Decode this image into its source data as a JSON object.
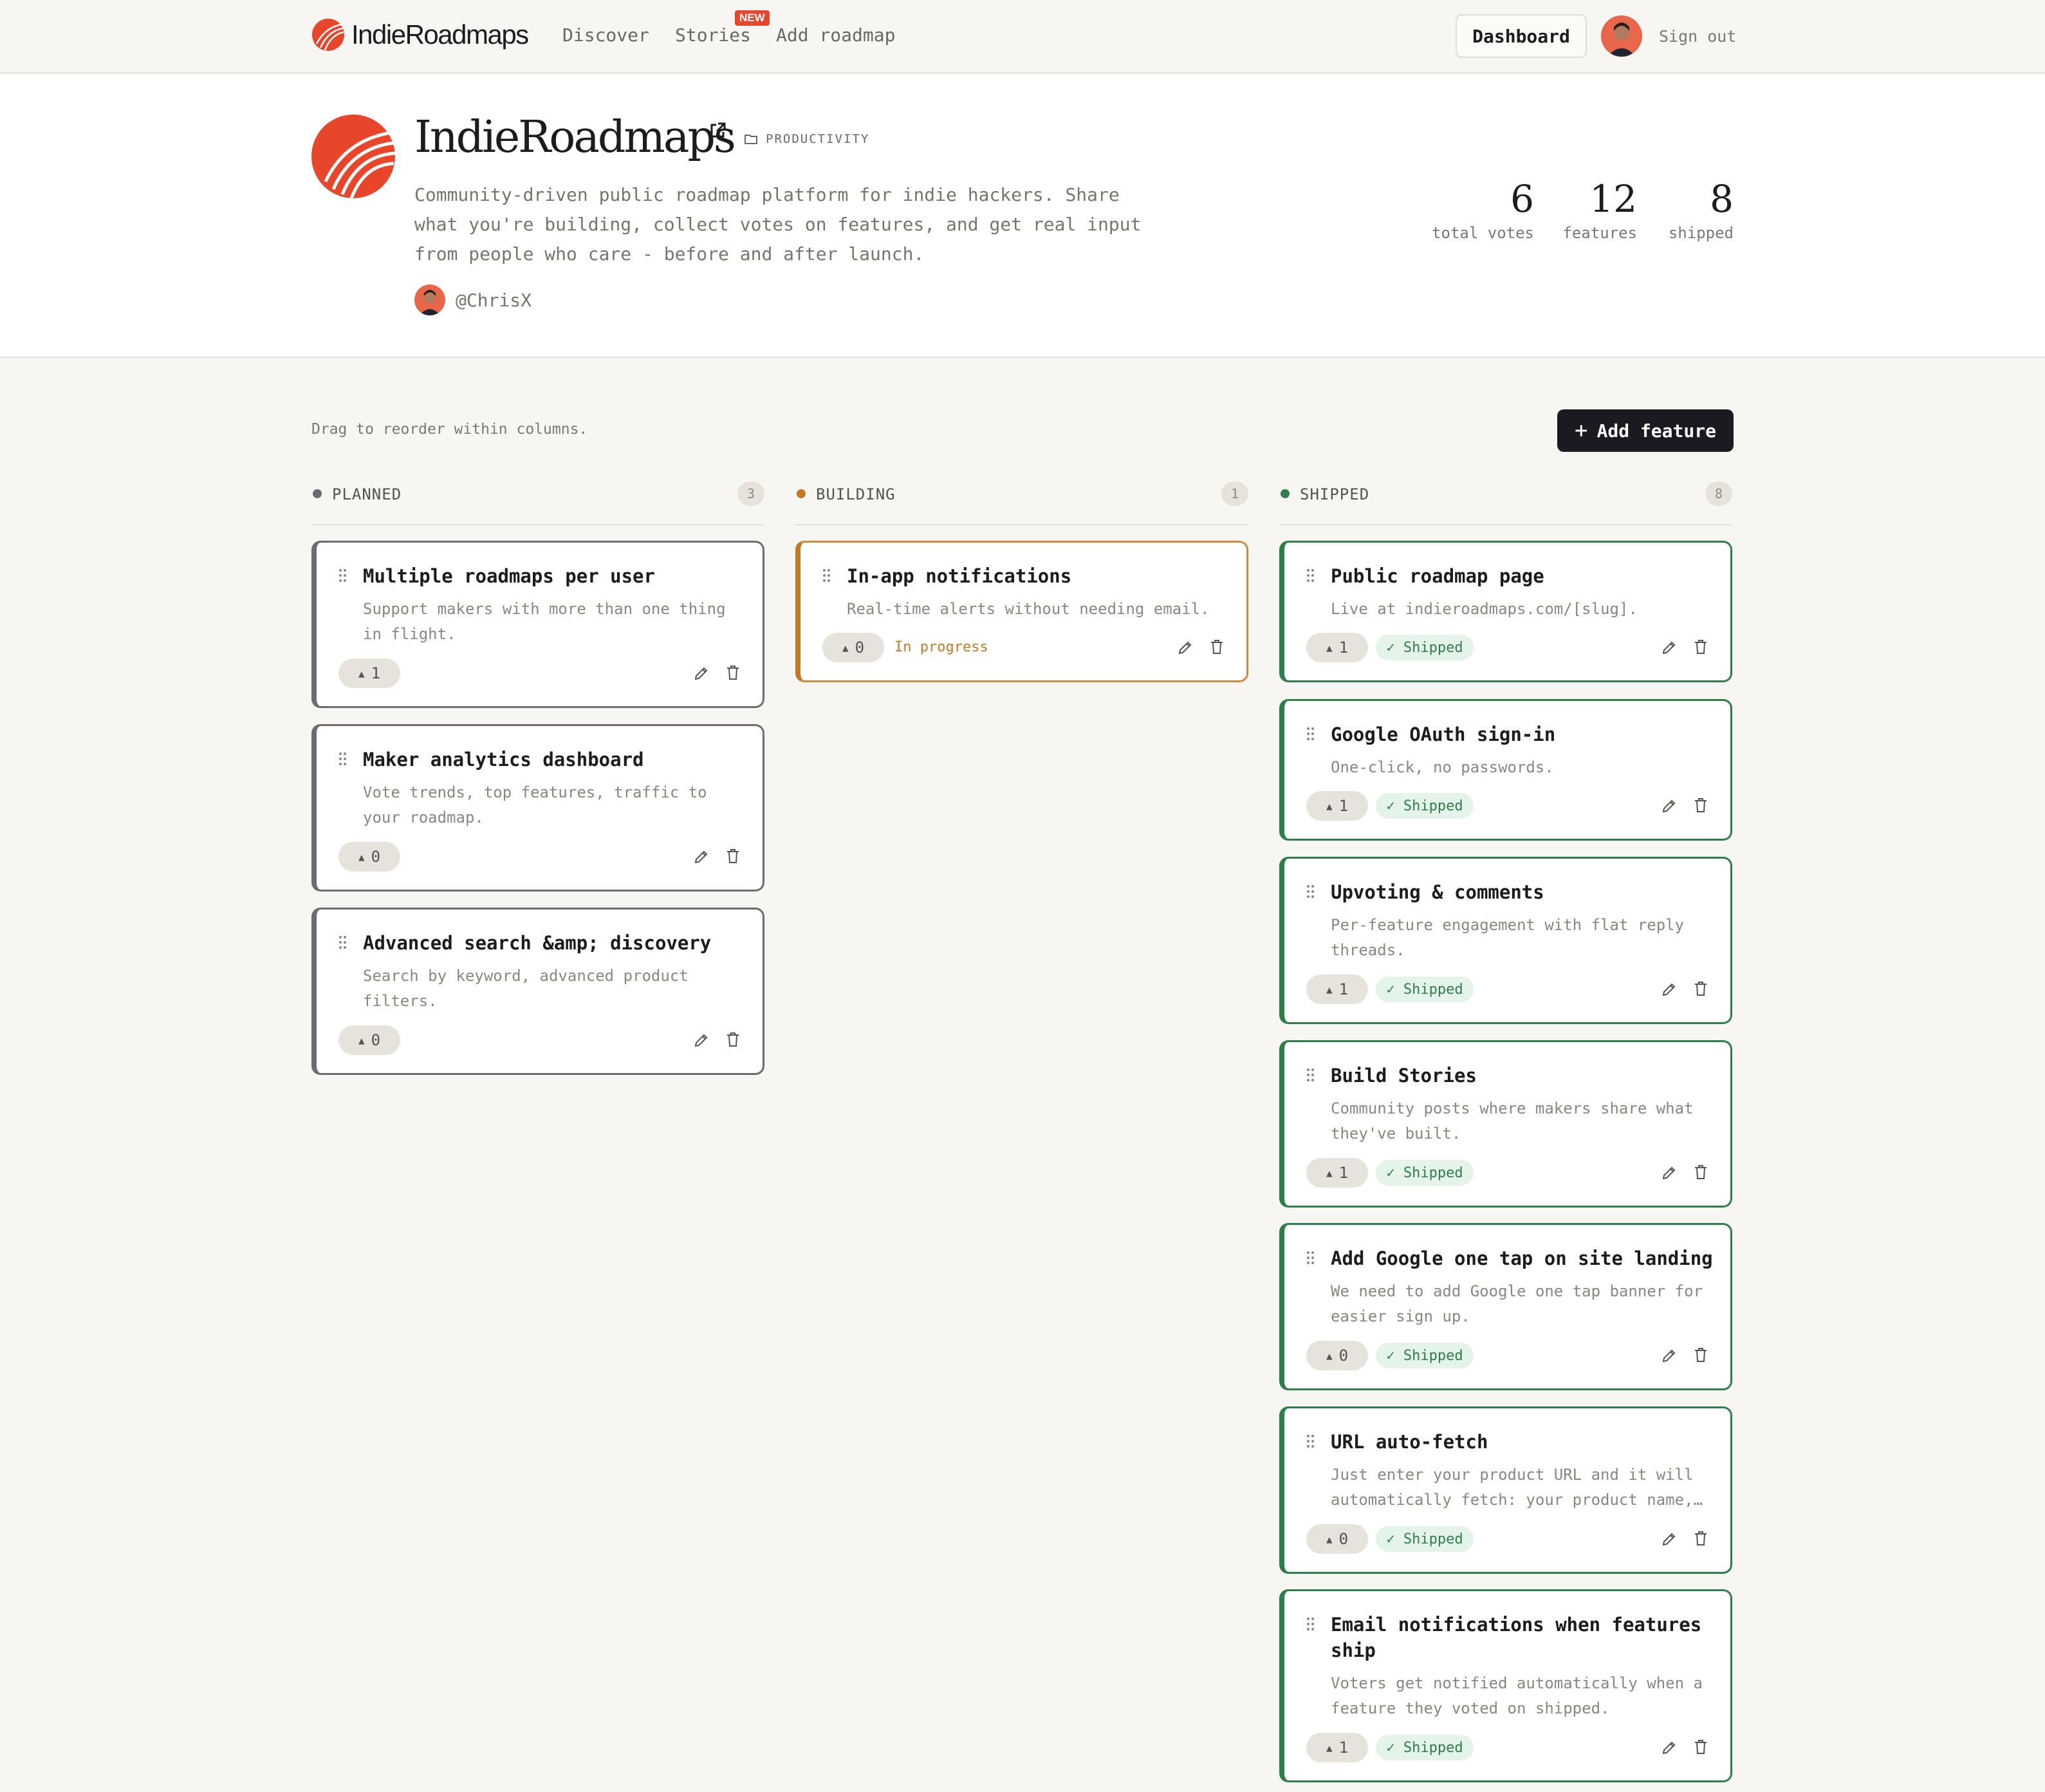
{
  "nav": {
    "brand": "IndieRoadmaps",
    "links": [
      "Discover",
      "Stories",
      "Add roadmap"
    ],
    "new_badge": "NEW",
    "dashboard": "Dashboard",
    "signout": "Sign out"
  },
  "product": {
    "name": "IndieRoadmaps",
    "category": "PRODUCTIVITY",
    "description": "Community-driven public roadmap platform for indie hackers. Share what you're building, collect votes on features, and get real input from people who care - before and after launch.",
    "owner": "@ChrisX",
    "stats": [
      {
        "value": "6",
        "label": "total votes"
      },
      {
        "value": "12",
        "label": "features"
      },
      {
        "value": "8",
        "label": "shipped"
      }
    ]
  },
  "board": {
    "hint": "Drag to reorder within columns.",
    "add_button": "Add feature",
    "columns": [
      {
        "title": "PLANNED",
        "count": "3",
        "color": "#6c6b70",
        "cards": [
          {
            "title": "Multiple roadmaps per user",
            "desc": "Support makers with more than one thing in flight.",
            "votes": "1"
          },
          {
            "title": "Maker analytics dashboard",
            "desc": "Vote trends, top features, traffic to your roadmap.",
            "votes": "0"
          },
          {
            "title": "Advanced search &amp; discovery",
            "desc": "Search by keyword, advanced product filters.",
            "votes": "0"
          }
        ]
      },
      {
        "title": "BUILDING",
        "count": "1",
        "color": "#c27a26",
        "cards": [
          {
            "title": "In-app notifications",
            "desc": "Real-time alerts without needing email.",
            "votes": "0",
            "status": "In progress"
          }
        ]
      },
      {
        "title": "SHIPPED",
        "count": "8",
        "color": "#2e7d4a",
        "cards": [
          {
            "title": "Public roadmap page",
            "desc": "Live at indieroadmaps.com/[slug].",
            "votes": "1",
            "status": "✓ Shipped"
          },
          {
            "title": "Google OAuth sign-in",
            "desc": "One-click, no passwords.",
            "votes": "1",
            "status": "✓ Shipped"
          },
          {
            "title": "Upvoting & comments",
            "desc": "Per-feature engagement with flat reply threads.",
            "votes": "1",
            "status": "✓ Shipped"
          },
          {
            "title": "Build Stories",
            "desc": "Community posts where makers share what they've built.",
            "votes": "1",
            "status": "✓ Shipped"
          },
          {
            "title": "Add Google one tap on site landing",
            "desc": "We need to add Google one tap banner for easier sign up.",
            "votes": "0",
            "status": "✓ Shipped"
          },
          {
            "title": "URL auto-fetch",
            "desc": "Just enter your product URL and it will automatically fetch: your product name,…",
            "votes": "0",
            "status": "✓ Shipped"
          },
          {
            "title": "Email notifications when features ship",
            "desc": "Voters get notified automatically when a feature they voted on shipped.",
            "votes": "1",
            "status": "✓ Shipped"
          }
        ]
      }
    ]
  },
  "colors": {
    "accent": "#e8462a",
    "background": "#f7f6f2",
    "dark_button": "#1a1a20"
  },
  "icons": [
    "logo-icon",
    "external-link-icon",
    "folder-icon",
    "grip-icon",
    "upvote-icon",
    "edit-icon",
    "trash-icon",
    "plus-icon",
    "avatar"
  ]
}
